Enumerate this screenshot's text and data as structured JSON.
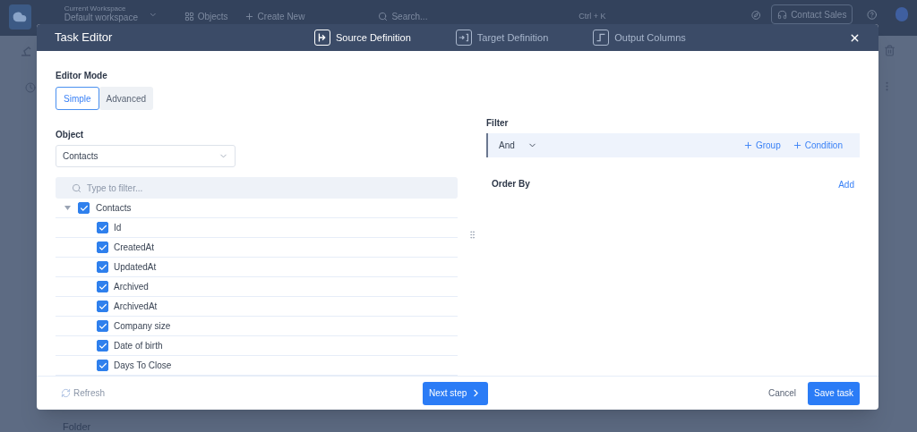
{
  "app_bar": {
    "workspace_label": "Current Workspace",
    "workspace_name": "Default workspace",
    "objects": "Objects",
    "create_new": "Create New",
    "search": {
      "placeholder": "Search..."
    },
    "shortcut": "Ctrl + K",
    "contact_sales": "Contact Sales"
  },
  "background": {
    "folder_label": "Folder"
  },
  "modal": {
    "title": "Task Editor",
    "steps": [
      {
        "label": "Source Definition",
        "selected": true,
        "kind": "source"
      },
      {
        "label": "Target Definition",
        "selected": false,
        "kind": "target"
      },
      {
        "label": "Output Columns",
        "selected": false,
        "kind": "output"
      }
    ],
    "editor_mode": {
      "label": "Editor Mode",
      "options": [
        {
          "label": "Simple",
          "selected": true
        },
        {
          "label": "Advanced",
          "selected": false
        }
      ]
    },
    "object": {
      "label": "Object",
      "value": "Contacts"
    },
    "tree": {
      "placeholder": "Type to filter...",
      "root": {
        "label": "Contacts",
        "checked": true,
        "expanded": true,
        "children": [
          {
            "label": "Id",
            "checked": true
          },
          {
            "label": "CreatedAt",
            "checked": true
          },
          {
            "label": "UpdatedAt",
            "checked": true
          },
          {
            "label": "Archived",
            "checked": true
          },
          {
            "label": "ArchivedAt",
            "checked": true
          },
          {
            "label": "Company size",
            "checked": true
          },
          {
            "label": "Date of birth",
            "checked": true
          },
          {
            "label": "Days To Close",
            "checked": true
          }
        ]
      }
    },
    "filter": {
      "label": "Filter",
      "operator": "And",
      "group": "Group",
      "condition": "Condition"
    },
    "order_by": {
      "label": "Order By",
      "add": "Add"
    },
    "footer": {
      "refresh": "Refresh",
      "next": "Next step",
      "cancel": "Cancel",
      "save": "Save task"
    }
  }
}
